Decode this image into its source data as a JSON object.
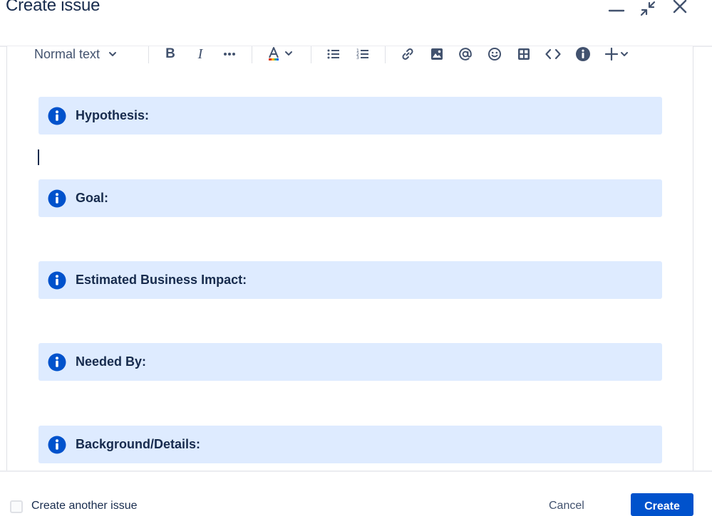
{
  "dialog": {
    "title": "Create issue"
  },
  "toolbar": {
    "text_style": "Normal text",
    "icons": [
      "bold-icon",
      "italic-icon",
      "more-formatting-icon",
      "text-color-icon",
      "bullet-list-icon",
      "numbered-list-icon",
      "link-icon",
      "image-icon",
      "mention-icon",
      "emoji-icon",
      "table-icon",
      "code-icon",
      "info-panel-icon",
      "insert-plus-icon"
    ]
  },
  "panels": [
    {
      "label": "Hypothesis:"
    },
    {
      "label": "Goal:"
    },
    {
      "label": "Estimated Business Impact:"
    },
    {
      "label": "Needed By:"
    },
    {
      "label": "Background/Details:"
    }
  ],
  "footer": {
    "create_another_label": "Create another issue",
    "cancel_label": "Cancel",
    "create_label": "Create"
  },
  "colors": {
    "info_panel_bg": "#deebff",
    "info_icon": "#0052cc",
    "primary_button": "#0052cc",
    "text_primary": "#172b4d"
  }
}
